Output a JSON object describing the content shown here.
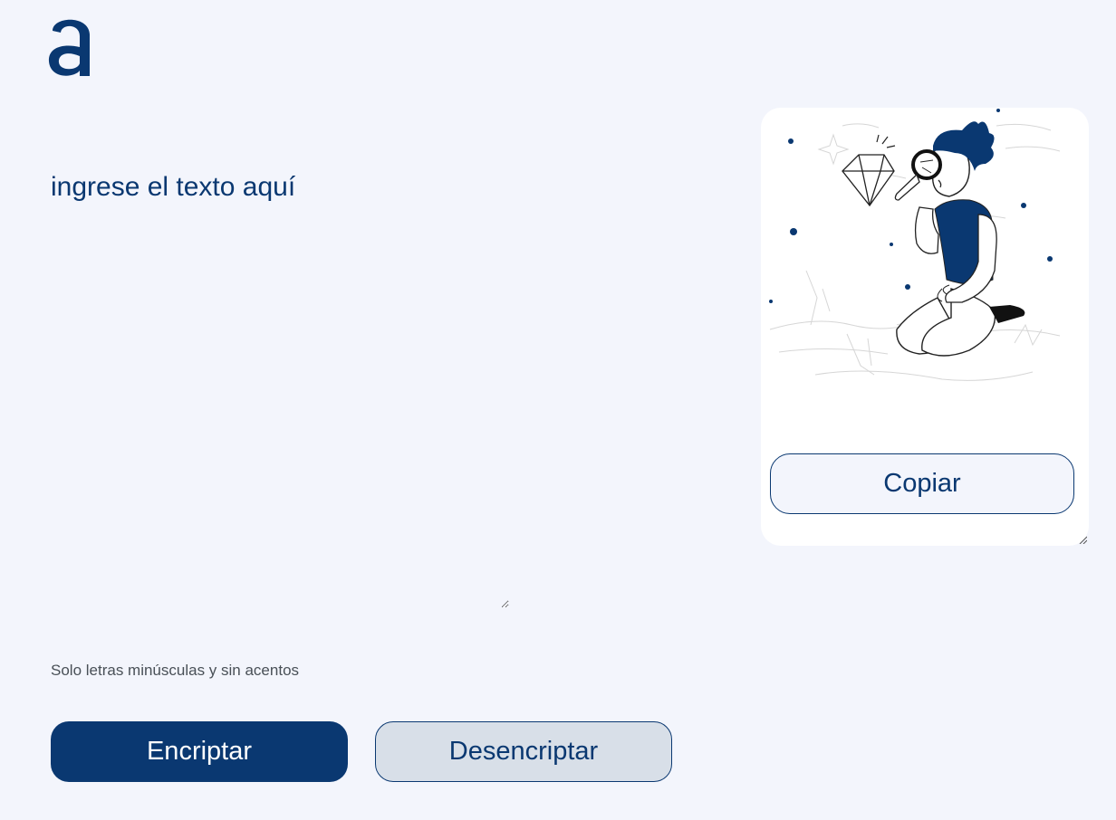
{
  "colors": {
    "background": "#F3F5FC",
    "primary": "#0A3871",
    "secondary_button_bg": "#D8DFE8",
    "card": "#FFFFFF",
    "hint_text": "#495057"
  },
  "header": {
    "logo_icon": "alura-a-logo"
  },
  "main": {
    "input": {
      "placeholder": "ingrese el texto aquí",
      "value": ""
    },
    "hint": "Solo letras minúsculas y sin acentos",
    "buttons": {
      "encrypt_label": "Encriptar",
      "decrypt_label": "Desencriptar"
    }
  },
  "result_panel": {
    "illustration_icon": "person-with-magnifying-glass-diamond-illustration",
    "copy_label": "Copiar"
  }
}
